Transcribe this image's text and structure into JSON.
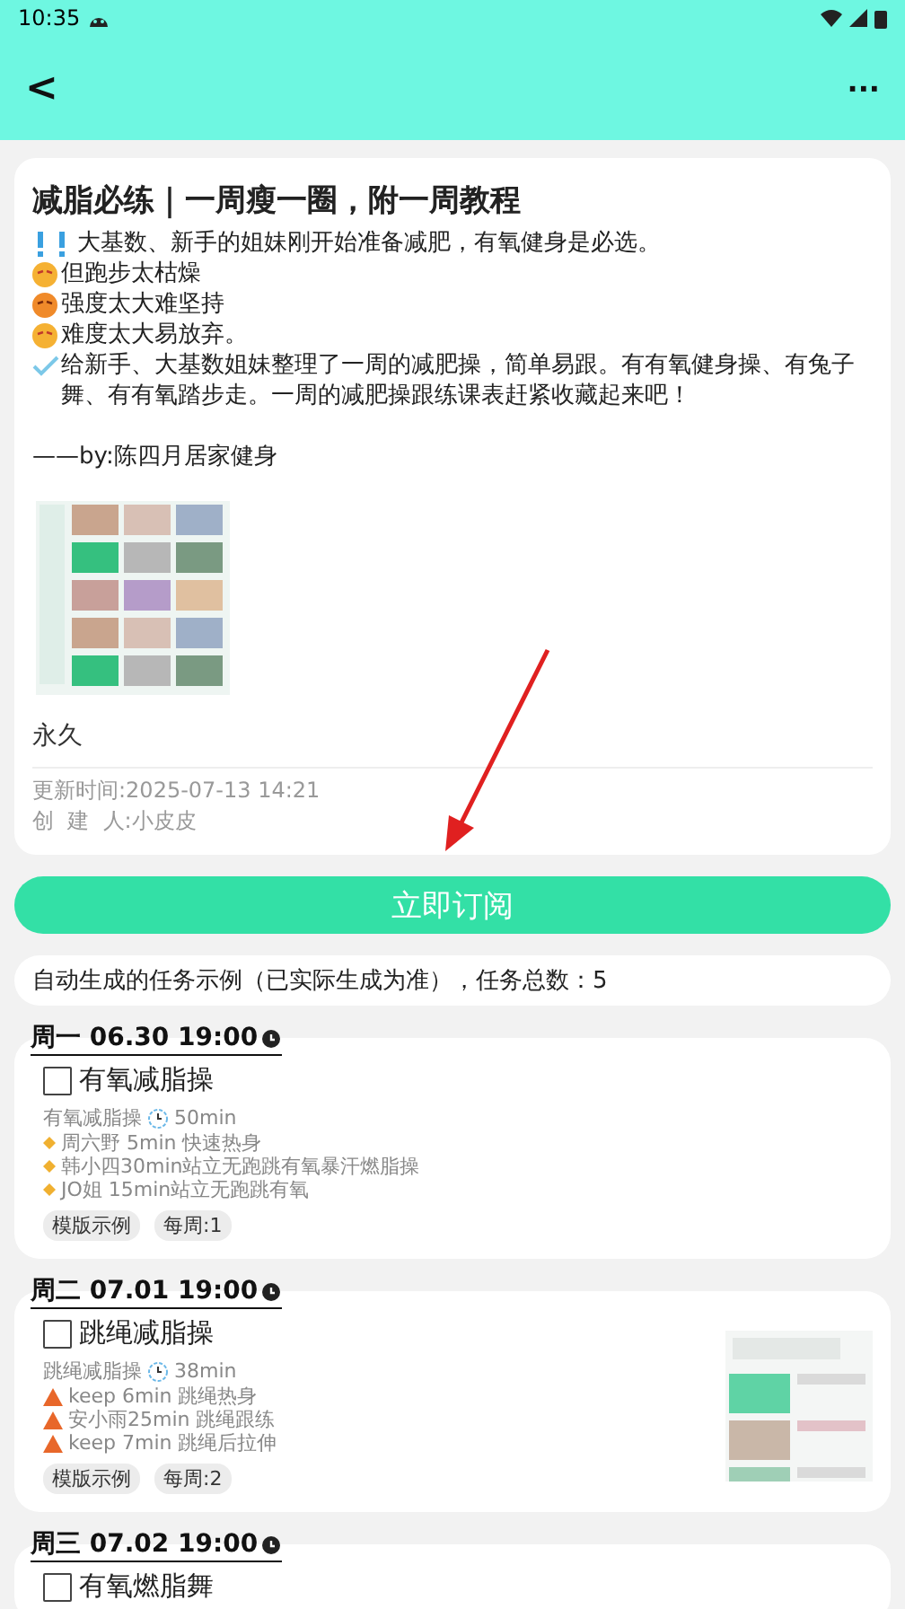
{
  "status_bar": {
    "time": "10:35"
  },
  "header": {
    "back": "<",
    "more": "···"
  },
  "plan": {
    "title": "减脂必练｜一周瘦一圈，附一周教程",
    "lines": [
      {
        "kind": "exclaim",
        "text": "大基数、新手的姐妹刚开始准备减肥，有氧健身是必选。"
      },
      {
        "kind": "face",
        "text": "但跑步太枯燥"
      },
      {
        "kind": "hot",
        "text": "强度太大难坚持"
      },
      {
        "kind": "face",
        "text": "难度太大易放弃。"
      },
      {
        "kind": "check",
        "text": "给新手、大基数姐妹整理了一周的减肥操，简单易跟。有有氧健身操、有兔子舞、有有氧踏步走。一周的减肥操跟练课表赶紧收藏起来吧！"
      },
      {
        "kind": "plain",
        "text": "——by:陈四月居家健身"
      }
    ],
    "image": {
      "kind": "picture"
    },
    "duration": "永久",
    "updated_label": "更新时间:",
    "updated": "2025-07-13 14:21",
    "creator_label": "创  建  人:",
    "creator": "小皮皮"
  },
  "subscribe_button": "立即订阅",
  "summary": "自动生成的任务示例（已实际生成为准），任务总数：5",
  "tasks": [
    {
      "date": "周一 06.30 19:00",
      "checked": false,
      "title": "有氧减脂操",
      "subtitle": "有氧减脂操",
      "minutes": "50min",
      "kind": "diamond",
      "steps": [
        "周六野 5min 快速热身",
        "韩小四30min站立无跑跳有氧暴汗燃脂操",
        "JO姐 15min站立无跑跳有氧"
      ],
      "tags": [
        "模版示例",
        "每周:1"
      ]
    },
    {
      "date": "周二 07.01 19:00",
      "checked": false,
      "title": "跳绳减脂操",
      "subtitle": "跳绳减脂操",
      "minutes": "38min",
      "kind": "triangle",
      "steps": [
        "keep 6min 跳绳热身",
        "安小雨25min 跳绳跟练",
        "keep 7min 跳绳后拉伸"
      ],
      "tags": [
        "模版示例",
        "每周:2"
      ],
      "image": {
        "kind": "picture"
      }
    },
    {
      "date": "周三 07.02 19:00",
      "checked": false,
      "title": "有氧燃脂舞"
    }
  ],
  "annotation": {
    "kind": "arrow"
  }
}
